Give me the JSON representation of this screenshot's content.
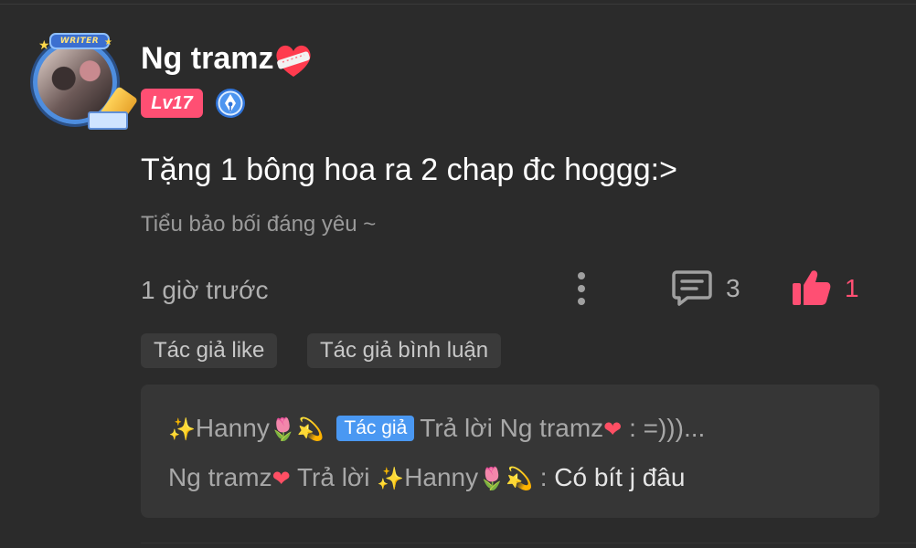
{
  "post": {
    "author": {
      "name": "Ng tramz",
      "name_emoji": "heart-with-bandage",
      "avatar_badge": "WRITER",
      "level": "Lv17",
      "writer_badge_icon": "pen-nib-badge-icon"
    },
    "content": "Tặng 1 bông hoa ra 2 chap đc hoggg:>",
    "signature": "Tiểu bảo bối đáng yêu ~",
    "timestamp": "1 giờ trước",
    "comment_count": "3",
    "like_count": "1",
    "tags": [
      "Tác giả like",
      "Tác giả bình luận"
    ]
  },
  "replies": [
    {
      "from": "Hanny",
      "from_prefix_emoji": "✨",
      "from_suffix_emoji": [
        "🌷",
        "💫"
      ],
      "badge": "Tác giả",
      "action": "Trả lời",
      "to": "Ng tramz",
      "to_emoji": "❤",
      "separator": ":",
      "text": "=)))..."
    },
    {
      "from": "Ng tramz",
      "from_emoji": "❤",
      "action": "Trả lời",
      "to": "Hanny",
      "to_prefix_emoji": "✨",
      "to_suffix_emoji": [
        "🌷",
        "💫"
      ],
      "separator": ":",
      "text": "Có bít j đâu"
    }
  ],
  "colors": {
    "background": "#2b2b2b",
    "accent_pink": "#ff4f73",
    "author_badge_blue": "#4a98f2",
    "reply_panel": "#363636",
    "muted_text": "#b0b0b0"
  }
}
